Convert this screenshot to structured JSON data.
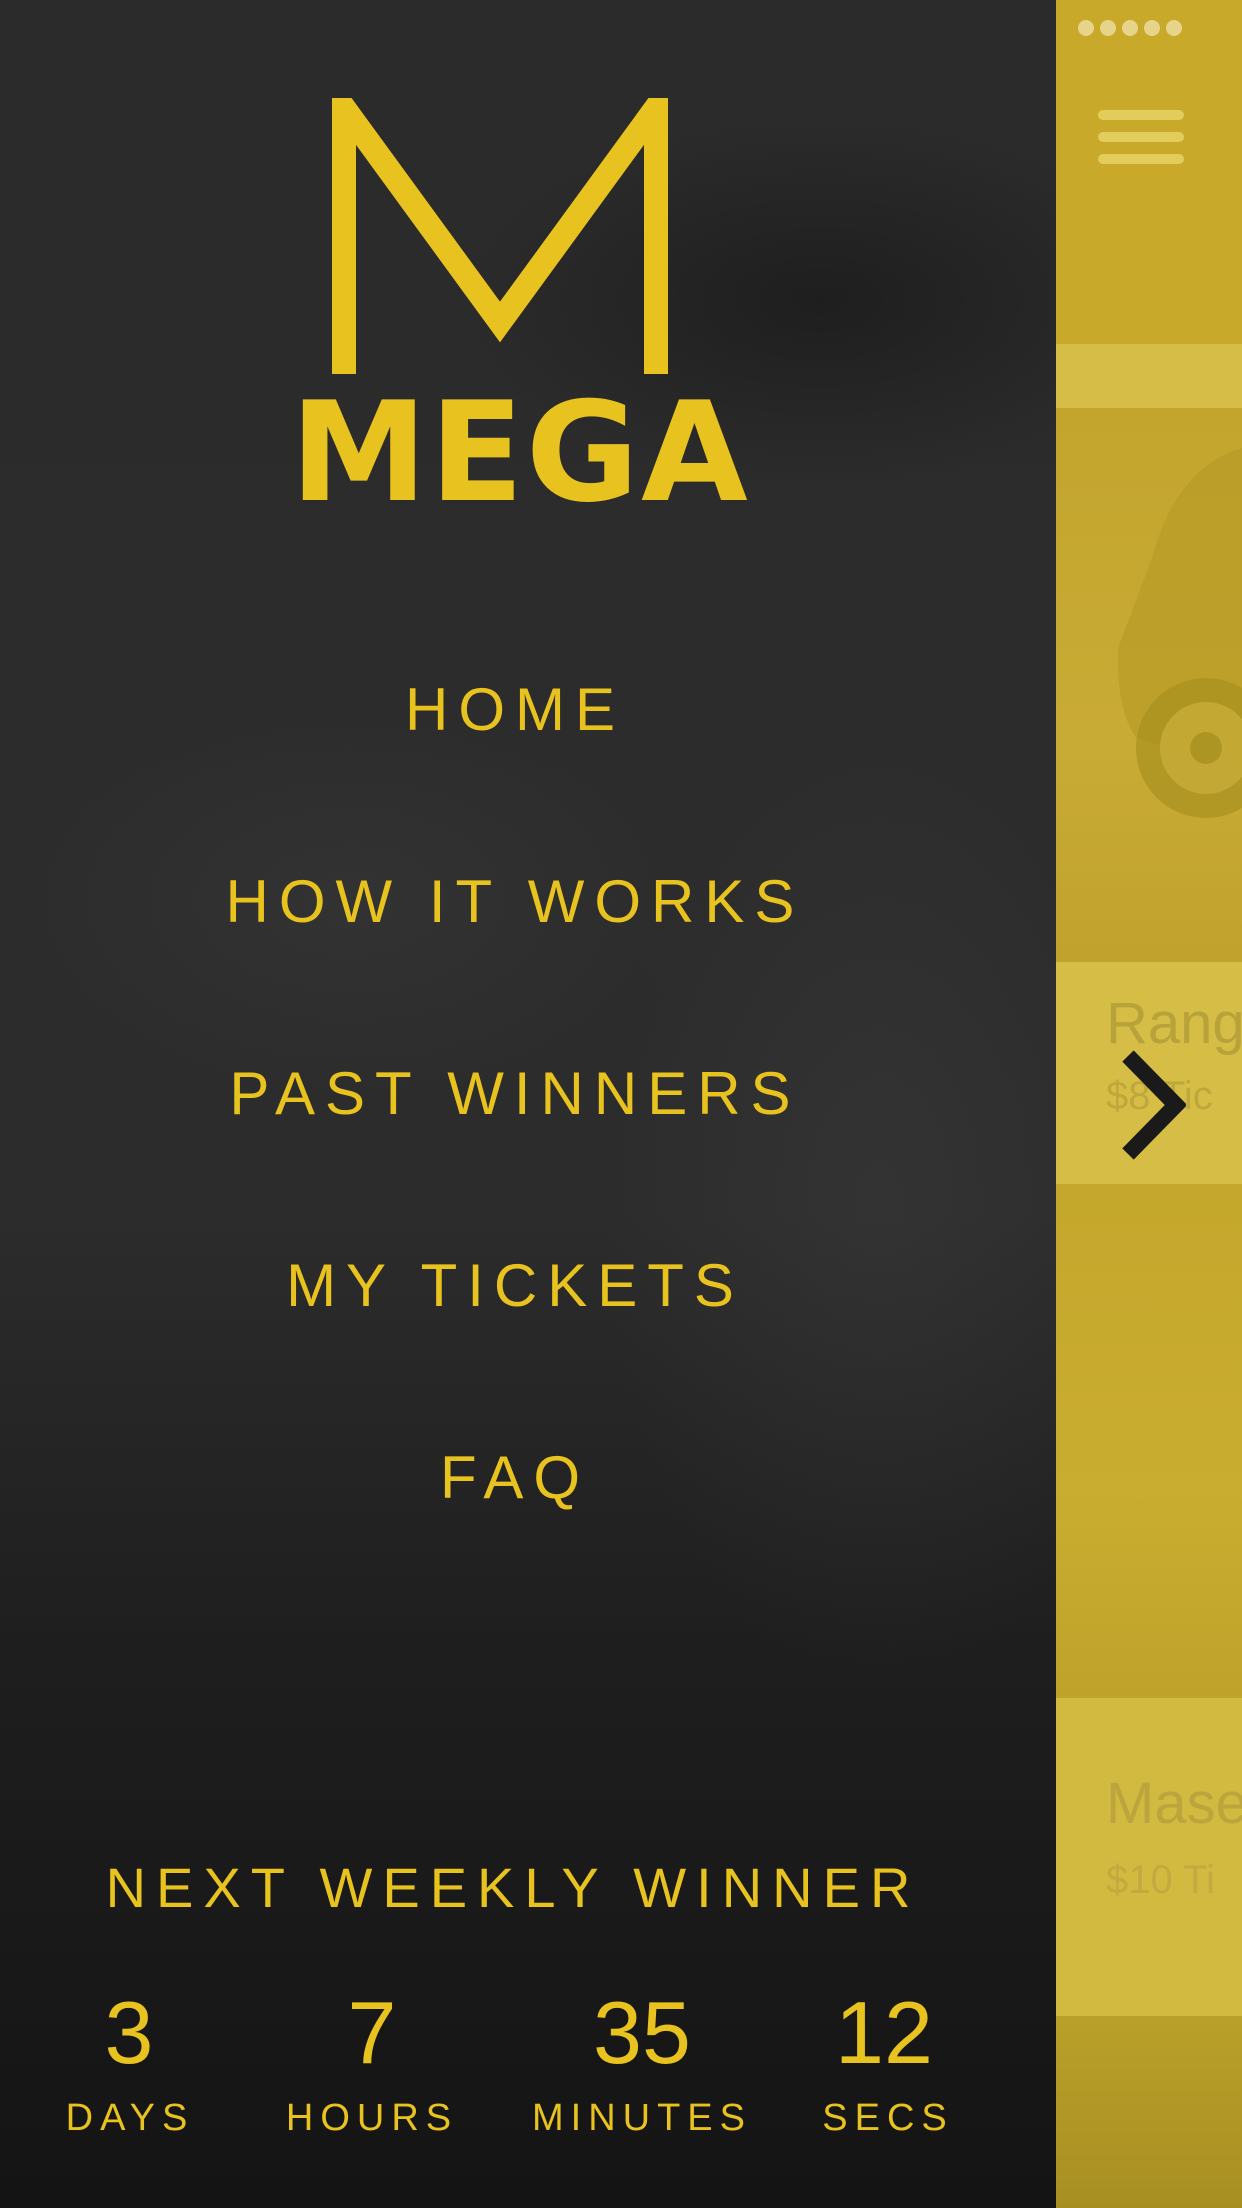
{
  "brand": {
    "name": "MEGA",
    "logo_icon": "M-logo-icon",
    "color": "#e8c21e"
  },
  "menu": {
    "items": [
      {
        "label": "HOME"
      },
      {
        "label": "HOW IT WORKS"
      },
      {
        "label": "PAST WINNERS"
      },
      {
        "label": "MY TICKETS"
      },
      {
        "label": "FAQ"
      }
    ]
  },
  "countdown": {
    "title": "NEXT WEEKLY WINNER",
    "units": [
      {
        "value": "3",
        "label": "DAYS"
      },
      {
        "value": "7",
        "label": "HOURS"
      },
      {
        "value": "35",
        "label": "MINUTES"
      },
      {
        "value": "12",
        "label": "SECS"
      }
    ]
  },
  "peek": {
    "background": "#c9a92a",
    "status_dots": 5,
    "menu_icon": "hamburger-icon",
    "next_icon": "chevron-right-icon",
    "cards": [
      {
        "title": "Rang",
        "price": "$8 Tic"
      },
      {
        "title": "Mase",
        "price": "$10 Ti"
      }
    ]
  },
  "colors": {
    "accent": "#e8c21e",
    "drawer_bg": "#2b2b2b",
    "peek_bg": "#c9a92a",
    "arrow": "#1a1a1a"
  }
}
